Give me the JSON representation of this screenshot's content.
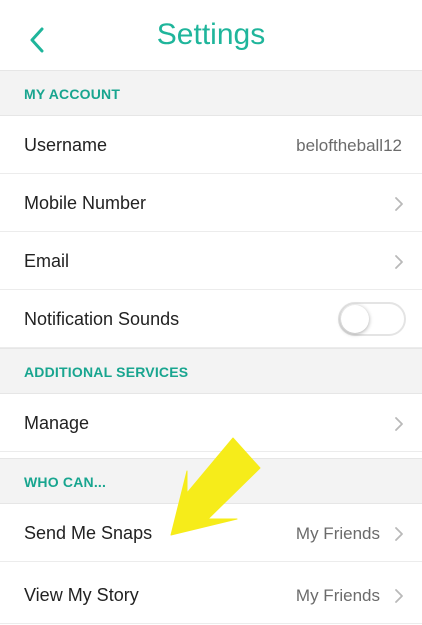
{
  "header": {
    "title": "Settings",
    "back_icon": "chevron-left-icon"
  },
  "sections": {
    "my_account": {
      "title": "MY ACCOUNT",
      "username_label": "Username",
      "username_value": "beloftheball12",
      "mobile_label": "Mobile Number",
      "email_label": "Email",
      "notification_label": "Notification Sounds",
      "notification_on": false
    },
    "additional_services": {
      "title": "ADDITIONAL SERVICES",
      "manage_label": "Manage"
    },
    "who_can": {
      "title": "WHO CAN...",
      "send_snaps_label": "Send Me Snaps",
      "send_snaps_value": "My Friends",
      "view_story_label": "View My Story",
      "view_story_value": "My Friends"
    }
  },
  "colors": {
    "accent": "#1fb59b",
    "section_title": "#18a58f",
    "annotation_arrow": "#f6ec1a"
  }
}
